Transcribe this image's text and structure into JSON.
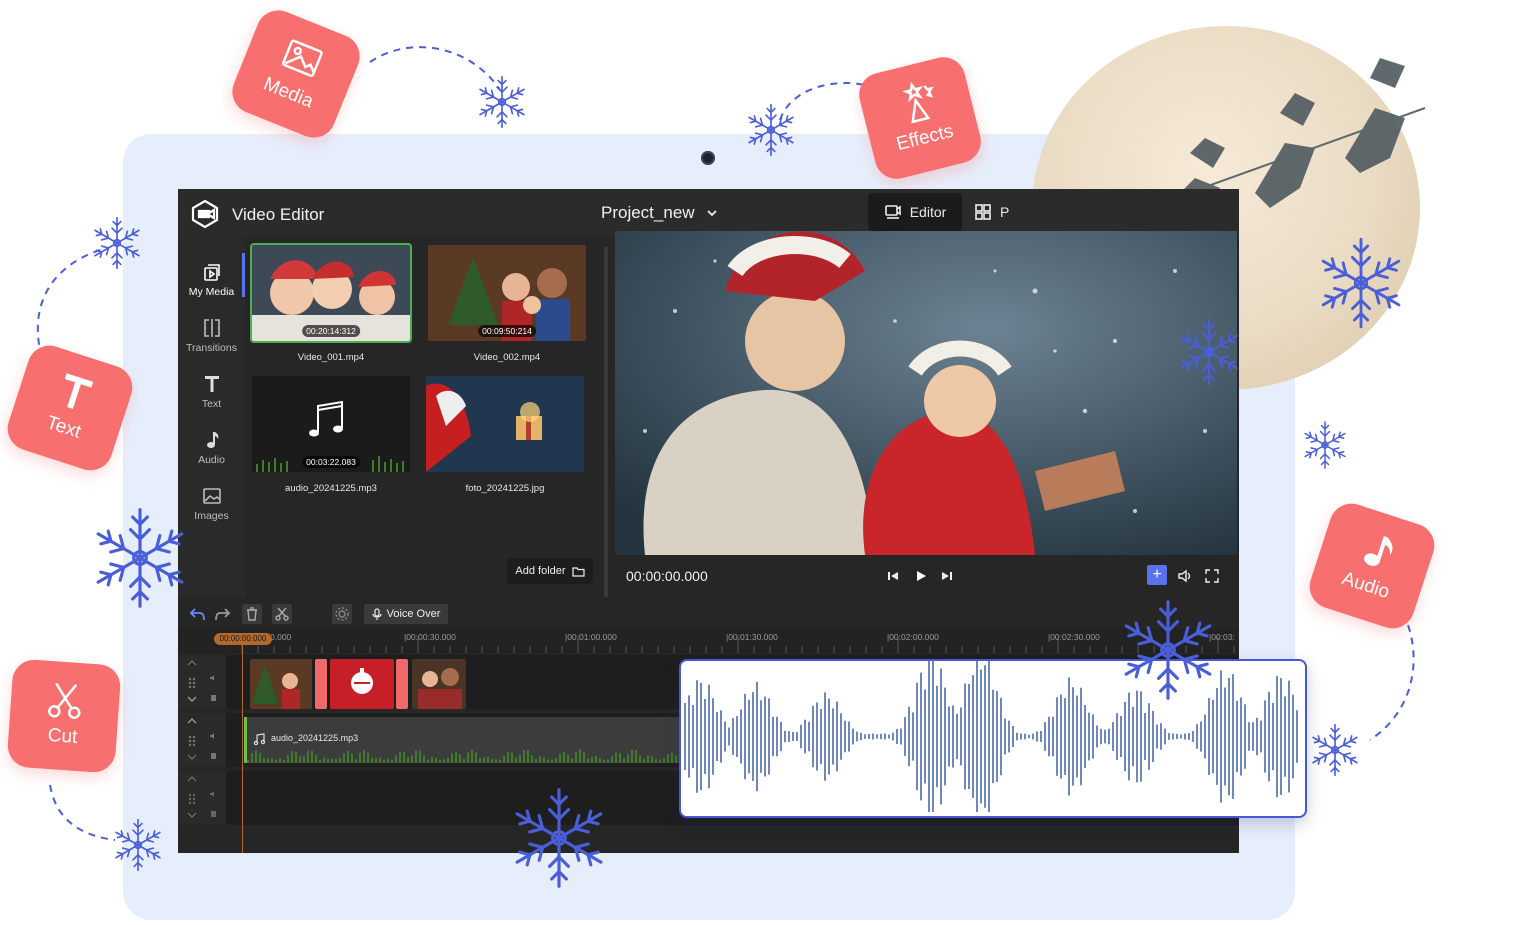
{
  "app": {
    "title": "Video Editor",
    "project_name": "Project_new",
    "modes": {
      "editor": "Editor",
      "other": "P"
    }
  },
  "sidebar": {
    "items": [
      {
        "label": "My Media",
        "icon": "my-media-icon",
        "active": true
      },
      {
        "label": "Transitions",
        "icon": "transitions-icon"
      },
      {
        "label": "Text",
        "icon": "text-icon"
      },
      {
        "label": "Audio",
        "icon": "audio-icon"
      },
      {
        "label": "Images",
        "icon": "images-icon"
      }
    ]
  },
  "media": {
    "items": [
      {
        "name": "Video_001.mp4",
        "duration": "00:20:14:312",
        "type": "video",
        "selected": true
      },
      {
        "name": "Video_002.mp4",
        "duration": "00:09:50:214",
        "type": "video"
      },
      {
        "name": "audio_20241225.mp3",
        "duration": "00:03:22.083",
        "type": "audio"
      },
      {
        "name": "foto_20241225.jpg",
        "type": "image"
      }
    ],
    "add_folder_label": "Add folder"
  },
  "preview": {
    "timecode": "00:00:00.000"
  },
  "timeline": {
    "voice_over_label": "Voice Over",
    "playhead_time": "00:00:00.000",
    "ruler_labels": [
      "0.000",
      "|00:00:30.000",
      "|00:01:00.000",
      "|00:01:30.000",
      "|00:02:00.000",
      "|00:02:30.000",
      "|00:03:"
    ],
    "audio_clip_name": "audio_20241225.mp3"
  },
  "badges": {
    "media": "Media",
    "effects": "Effects",
    "text": "Text",
    "audio": "Audio",
    "cut": "Cut"
  },
  "colors": {
    "accent": "#5b72f0",
    "badge": "#f86f6f",
    "frame": "#e6eefb",
    "snowflake": "#4a5ed8",
    "waveform": "#4b6aa6",
    "playhead": "#b3682d"
  }
}
